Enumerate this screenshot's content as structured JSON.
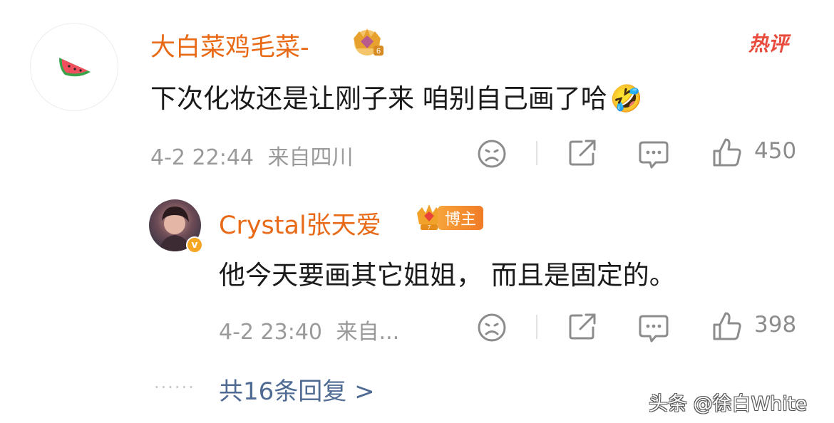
{
  "hot_label": "热评",
  "comment": {
    "username": "大白菜鸡毛菜-",
    "fan_level": "6",
    "text": "下次化妆还是让刚子来 咱别自己画了哈",
    "emoji": "🤣",
    "timestamp": "4-2 22:44",
    "location": "来自四川",
    "like_count": "450",
    "avatar_icon": "watermelon-icon"
  },
  "reply": {
    "username": "Crystal张天爱",
    "fan_level": "7",
    "badge": "博主",
    "verified": "v",
    "text": "他今天要画其它姐姐， 而且是固定的。",
    "timestamp": "4-2 23:40",
    "location": "来自...",
    "like_count": "398"
  },
  "more_replies": {
    "dots": "······",
    "label": "共16条回复 >"
  },
  "watermark": "头条 @徐白White",
  "colors": {
    "username": "#e86a17",
    "link": "#4f6b93",
    "meta": "#9a9a9a",
    "hot": "#e84b3c"
  }
}
